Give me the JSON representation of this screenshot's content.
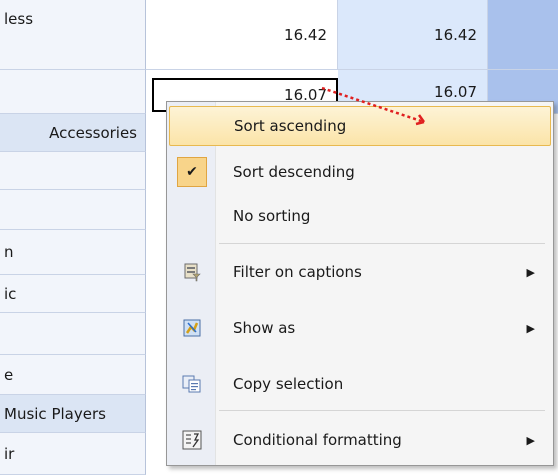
{
  "grid": {
    "rows": [
      {
        "label": "less",
        "v1": "16.42",
        "v2": "16.42"
      },
      {
        "label": "",
        "v1": "16.07",
        "v2": "16.07"
      },
      {
        "label": "Accessories",
        "v1": "",
        "v2": ""
      },
      {
        "label": "",
        "v1": "",
        "v2": ""
      },
      {
        "label": "",
        "v1": "",
        "v2": ""
      },
      {
        "label": "n",
        "v1": "",
        "v2": ""
      },
      {
        "label": "ic",
        "v1": "",
        "v2": ""
      },
      {
        "label": "",
        "v1": "",
        "v2": ""
      },
      {
        "label": "e",
        "v1": "",
        "v2": ""
      },
      {
        "label": "Music Players",
        "v1": "",
        "v2": ""
      },
      {
        "label": "ir",
        "v1": "",
        "v2": ""
      }
    ]
  },
  "menu": {
    "items": [
      {
        "label": "Sort ascending",
        "icon": "none",
        "submenu": false,
        "state": "hover"
      },
      {
        "label": "Sort descending",
        "icon": "check-icon",
        "submenu": false,
        "state": "checked"
      },
      {
        "label": "No sorting",
        "icon": "none",
        "submenu": false
      },
      {
        "label": "Filter on captions",
        "icon": "filter-icon",
        "submenu": true
      },
      {
        "label": "Show as",
        "icon": "show-as-icon",
        "submenu": true
      },
      {
        "label": "Copy selection",
        "icon": "copy-icon",
        "submenu": false
      },
      {
        "label": "Conditional formatting",
        "icon": "conditional-formatting-icon",
        "submenu": true
      }
    ],
    "submenu_glyph": "▶",
    "check_glyph": "✔"
  },
  "colors": {
    "hover_highlight": "#fbe4a8",
    "selected_border": "#000000",
    "dotted_arrow": "#ff0000"
  }
}
